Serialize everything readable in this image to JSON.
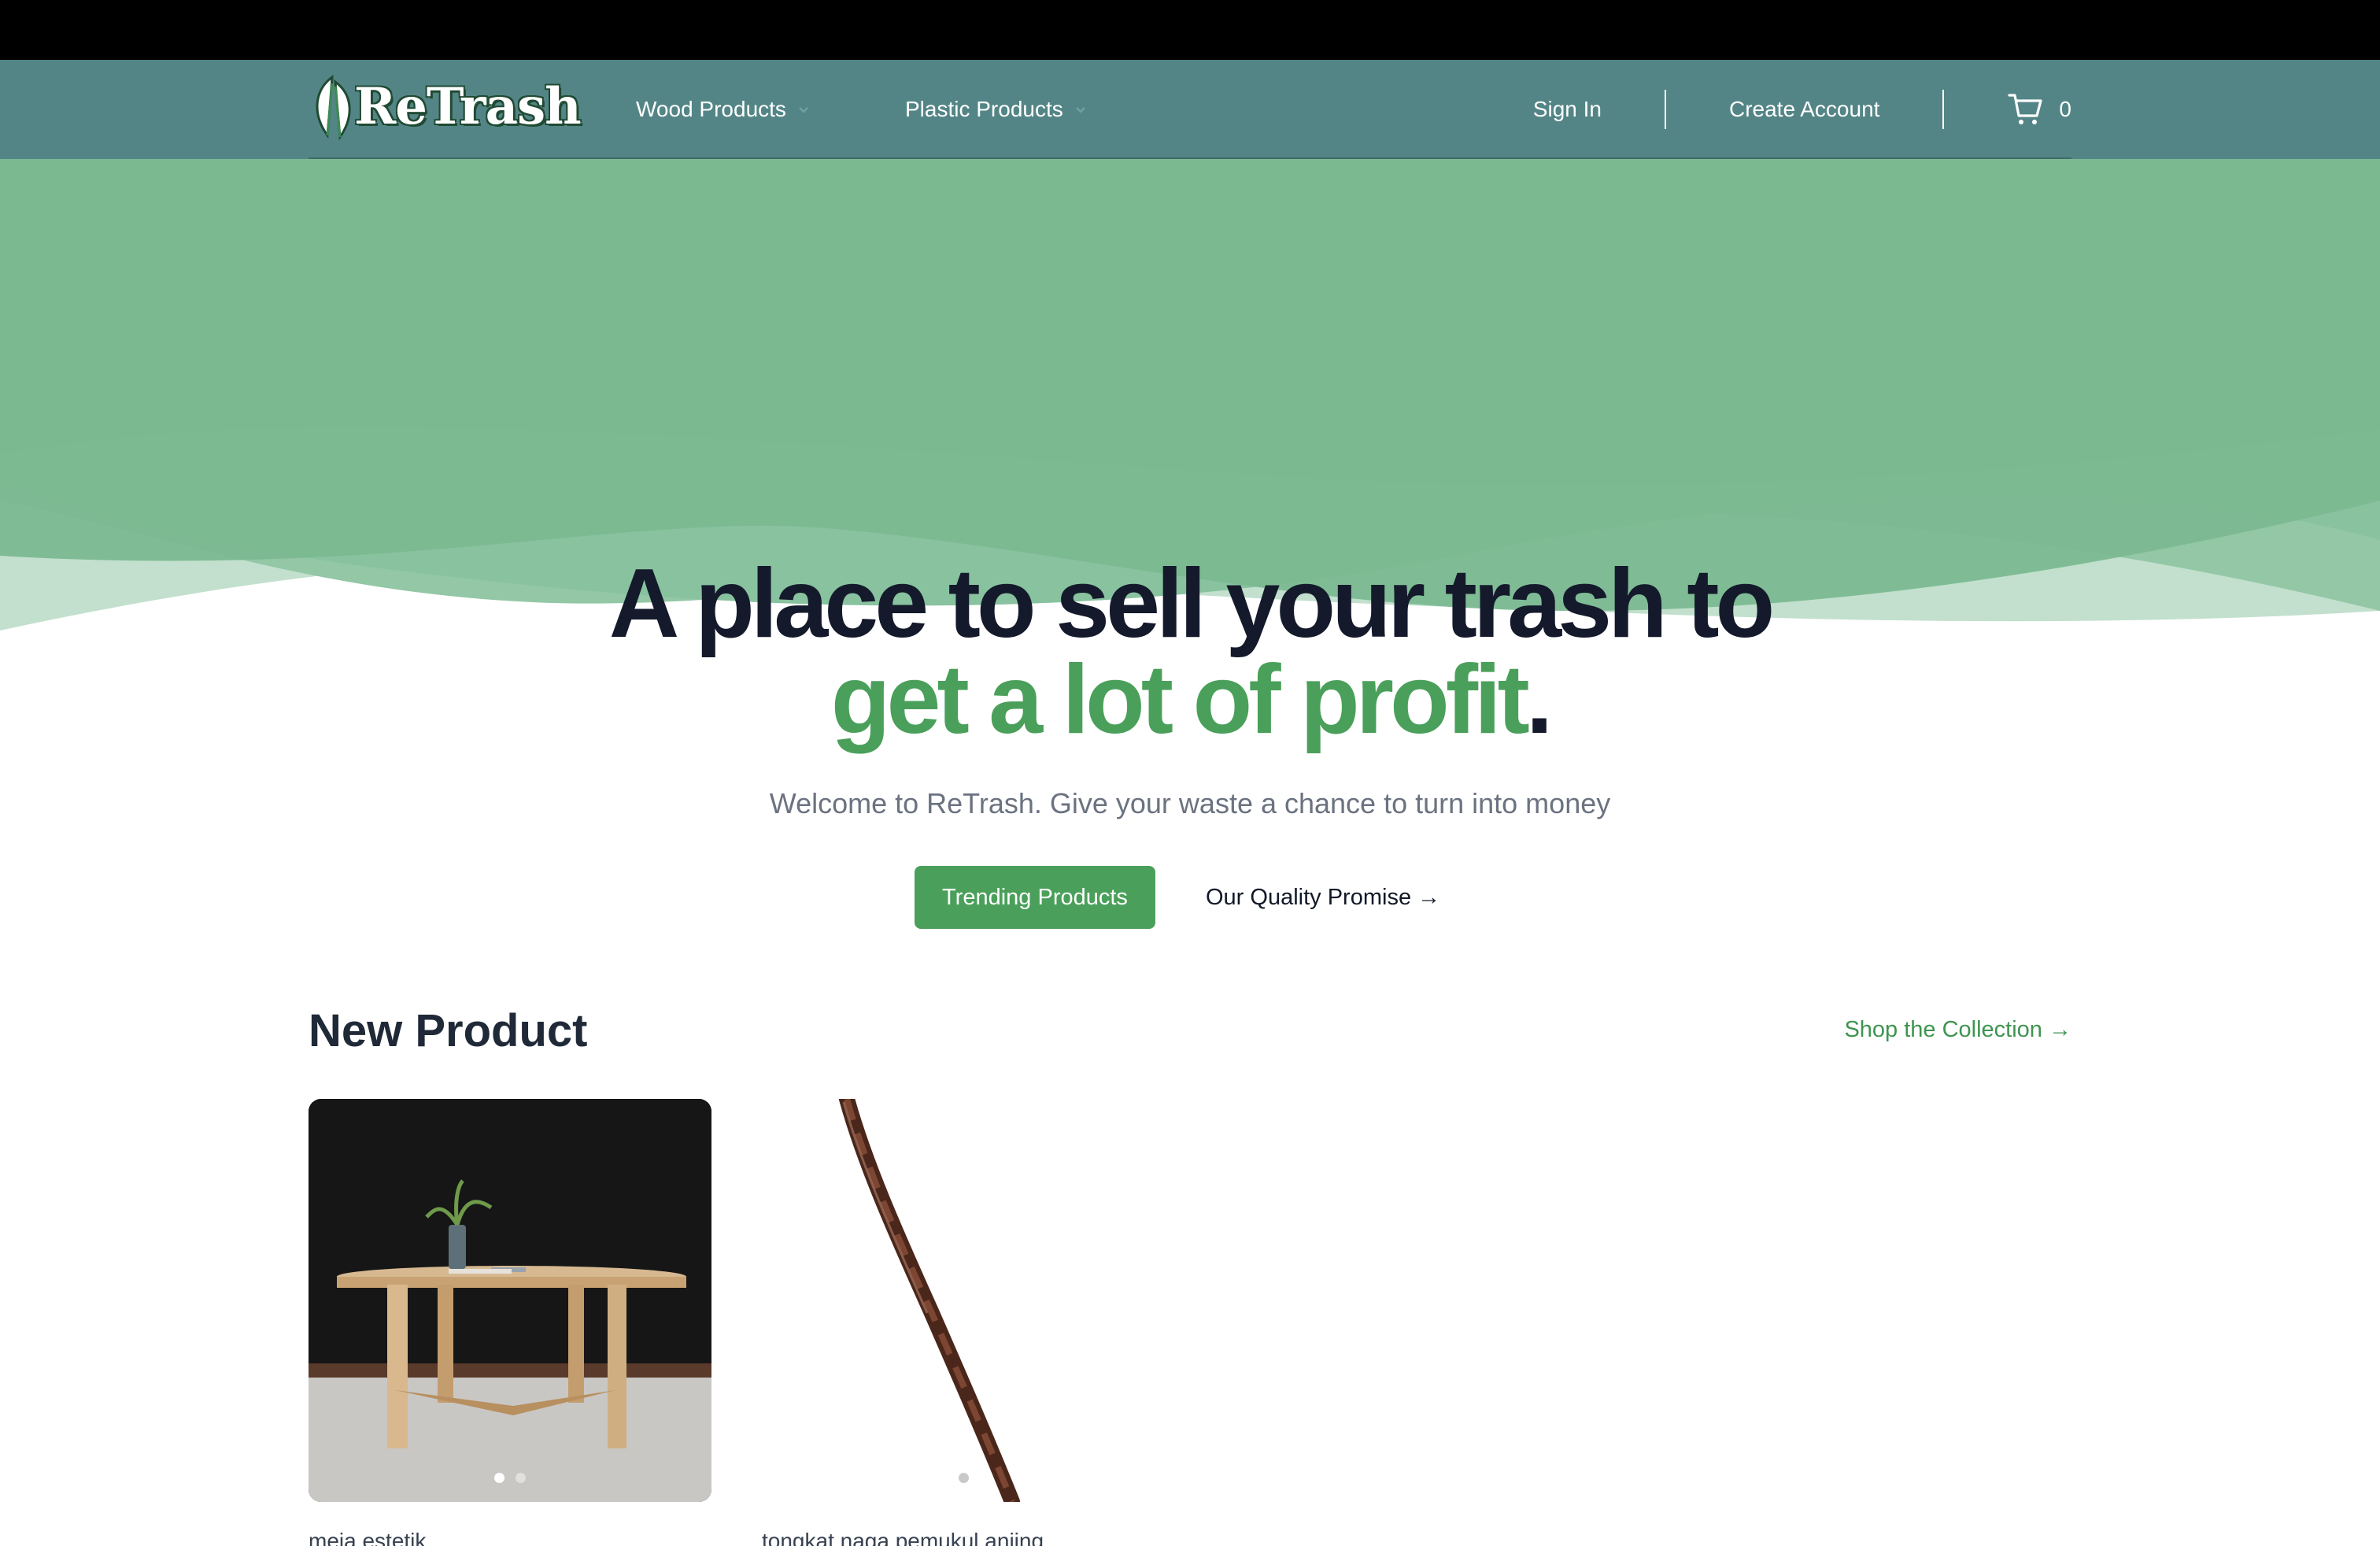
{
  "brand": {
    "logo_text": "ReTrash"
  },
  "nav": {
    "menus": [
      {
        "label": "Wood Products"
      },
      {
        "label": "Plastic Products"
      }
    ],
    "sign_in": "Sign In",
    "create_account": "Create Account",
    "cart_count": "0"
  },
  "hero": {
    "headline_line1": "A place to sell your trash to",
    "headline_highlight": "get a lot of profit",
    "headline_end": ".",
    "subtitle": "Welcome to ReTrash. Give your waste a chance to turn into money",
    "primary_cta": "Trending Products",
    "secondary_cta": "Our Quality Promise →"
  },
  "new_products": {
    "title": "New Product",
    "shop_link": "Shop the Collection →",
    "items": [
      {
        "name": "meja estetik",
        "images": 2,
        "active_image": 1
      },
      {
        "name": "tongkat naga pemukul anjing",
        "images": 1,
        "active_image": 1
      }
    ]
  },
  "colors": {
    "nav_bg": "#548586",
    "hero_green": "#7bb991",
    "accent_green": "#4aa05a",
    "headline_dark": "#141a2b"
  }
}
